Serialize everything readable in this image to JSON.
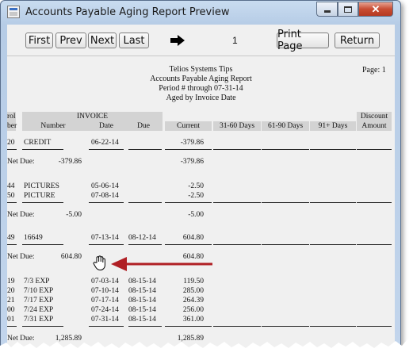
{
  "window": {
    "title": "Accounts Payable Aging Report Preview",
    "close_glyph": "✕"
  },
  "toolbar": {
    "first_label": "First",
    "prev_label": "Prev",
    "next_label": "Next",
    "last_label": "Last",
    "page_number": "1",
    "print_label": "Print Page",
    "return_label": "Return",
    "arrow_icon": "right-arrow-icon"
  },
  "report": {
    "company": "Telios Systems Tips",
    "title": "Accounts Payable Aging Report",
    "period": "Period # through 07-31-14",
    "aged_by": "Aged by Invoice Date",
    "page_label": "Page: 1",
    "columns": {
      "ctrl_top": "rol",
      "ctrl_bottom": "ber",
      "invoice_group": "INVOICE",
      "number": "Number",
      "date": "Date",
      "due": "Due",
      "current": "Current",
      "d31_60": "31-60 Days",
      "d61_90": "61-90 Days",
      "d91": "91+ Days",
      "discount_top": "Discount",
      "discount_bottom": "Amount"
    },
    "groups": [
      {
        "lines": [
          {
            "ctrl": "20",
            "number": "CREDIT",
            "date": "06-22-14",
            "due": "",
            "current": "-379.86"
          }
        ],
        "net_label": "Net Due:",
        "net_value": "-379.86",
        "net_current": "-379.86"
      },
      {
        "lines": [
          {
            "ctrl": "44",
            "number": "PICTURES",
            "date": "05-06-14",
            "due": "",
            "current": "-2.50"
          },
          {
            "ctrl": "50",
            "number": "PICTURE",
            "date": "07-08-14",
            "due": "",
            "current": "-2.50"
          }
        ],
        "net_label": "Net Due:",
        "net_value": "-5.00",
        "net_current": "-5.00"
      },
      {
        "lines": [
          {
            "ctrl": "49",
            "number": "16649",
            "date": "07-13-14",
            "due": "08-12-14",
            "current": "604.80"
          }
        ],
        "net_label": "Net Due:",
        "net_value": "604.80",
        "net_current": "604.80"
      },
      {
        "lines": [
          {
            "ctrl": "19",
            "number": "7/3 EXP",
            "date": "07-03-14",
            "due": "08-15-14",
            "current": "119.50"
          },
          {
            "ctrl": "20",
            "number": "7/10 EXP",
            "date": "07-10-14",
            "due": "08-15-14",
            "current": "285.00"
          },
          {
            "ctrl": "21",
            "number": "7/17 EXP",
            "date": "07-17-14",
            "due": "08-15-14",
            "current": "264.39"
          },
          {
            "ctrl": "00",
            "number": "7/24 EXP",
            "date": "07-24-14",
            "due": "08-15-14",
            "current": "256.00"
          },
          {
            "ctrl": "01",
            "number": "7/31 EXP",
            "date": "07-31-14",
            "due": "08-15-14",
            "current": "361.00"
          }
        ],
        "net_label": "Net Due:",
        "net_value": "1,285.89",
        "net_current": "1,285.89"
      }
    ]
  },
  "annotation": {
    "arrow_color": "#b01f24",
    "cursor_icon": "hand-cursor-icon"
  }
}
